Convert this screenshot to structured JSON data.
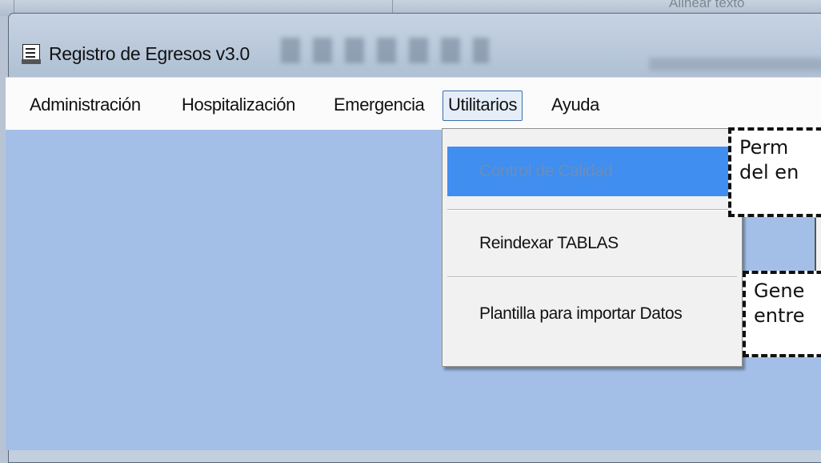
{
  "window": {
    "title": "Registro de Egresos v3.0",
    "title_icon": "app-document-icon"
  },
  "background_app": {
    "partial_text": "Alinear texto"
  },
  "menubar": {
    "items": [
      {
        "label": "Administración"
      },
      {
        "label": "Hospitalización"
      },
      {
        "label": "Emergencia"
      },
      {
        "label": "Utilitarios",
        "active": true
      },
      {
        "label": "Ayuda"
      }
    ]
  },
  "dropdown": {
    "parent": "Utilitarios",
    "items": [
      {
        "label": "Control de Calidad",
        "highlighted": true
      },
      {
        "label": "Reindexar TABLAS"
      },
      {
        "label": "Plantilla para importar Datos"
      }
    ]
  },
  "callouts": [
    {
      "line1": "Perm",
      "line2": "del en"
    },
    {
      "line1": "Gene",
      "line2": "entre"
    }
  ],
  "colors": {
    "client_area": "#a3bfe8",
    "menu_highlight": "#3f8ef0",
    "menu_background": "#f1f1f1"
  }
}
